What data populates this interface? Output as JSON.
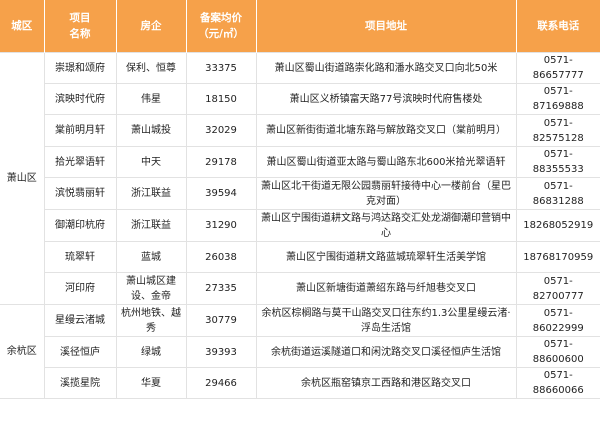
{
  "headers": {
    "district": "城区",
    "project_line1": "项目",
    "project_line2": "名称",
    "developer": "房企",
    "price_line1": "备案均价",
    "price_line2": "（元/㎡）",
    "address": "项目地址",
    "phone": "联系电话"
  },
  "groups": [
    {
      "district": "萧山区",
      "rows": [
        {
          "project": "崇璟和颂府",
          "developer": "保利、恒尊",
          "price": "33375",
          "address": "萧山区蜀山街道路崇化路和潘水路交叉口向北50米",
          "phone": "0571-86657777"
        },
        {
          "project": "滨映时代府",
          "developer": "伟星",
          "price": "18150",
          "address": "萧山区义桥镇富天路77号滨映时代府售楼处",
          "phone": "0571-87169888"
        },
        {
          "project": "棠前明月轩",
          "developer": "萧山城投",
          "price": "32029",
          "address": "萧山区新街街道北塘东路与解放路交叉口（棠前明月）",
          "phone": "0571-82575128"
        },
        {
          "project": "拾光翠语轩",
          "developer": "中天",
          "price": "29178",
          "address": "萧山区蜀山街道亚太路与蜀山路东北600米拾光翠语轩",
          "phone": "0571-88355533"
        },
        {
          "project": "滨悦翡丽轩",
          "developer": "浙江联益",
          "price": "39594",
          "address": "萧山区北干街道无限公园翡丽轩接待中心一楼前台（星巴克对面）",
          "phone": "0571-86831288"
        },
        {
          "project": "御潮印杭府",
          "developer": "浙江联益",
          "price": "31290",
          "address": "萧山区宁围街道耕文路与鸿达路交汇处龙湖御潮印营销中心",
          "phone": "18268052919"
        },
        {
          "project": "琉翠轩",
          "developer": "蓝城",
          "price": "26038",
          "address": "萧山区宁围街道耕文路蓝城琉翠轩生活美学馆",
          "phone": "18768170959"
        },
        {
          "project": "河印府",
          "developer": "萧山城区建设、金帝",
          "price": "27335",
          "address": "萧山区新塘街道萧绍东路与纤旭巷交叉口",
          "phone": "0571-82700777"
        }
      ]
    },
    {
      "district": "余杭区",
      "rows": [
        {
          "project": "星缦云渚城",
          "developer": "杭州地铁、越秀",
          "price": "30779",
          "address": "余杭区棕榈路与莫干山路交叉口往东约1.3公里星缦云渚·浮岛生活馆",
          "phone": "0571-86022999"
        },
        {
          "project": "溪径恒庐",
          "developer": "绿城",
          "price": "39393",
          "address": "余杭街道运溪隧道口和闲沈路交叉口溪径恒庐生活馆",
          "phone": "0571-88600600"
        },
        {
          "project": "溪揽星院",
          "developer": "华夏",
          "price": "29466",
          "address": "余杭区瓶窑镇京工西路和港区路交叉口",
          "phone": "0571-88660066"
        }
      ]
    }
  ]
}
